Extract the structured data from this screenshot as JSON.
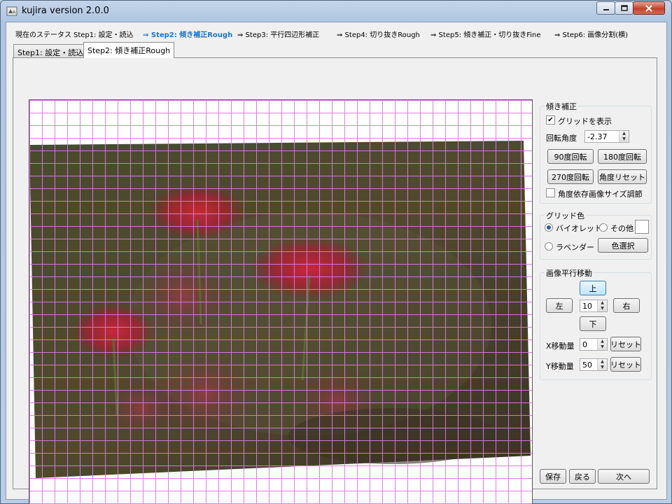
{
  "window": {
    "title": "kujira version 2.0.0"
  },
  "status": {
    "prefix": "現在のステータス",
    "steps": [
      {
        "text": "Step1: 設定・読込",
        "current": false
      },
      {
        "text": "⇒ Step2: 傾き補正Rough",
        "current": true
      },
      {
        "text": "⇒ Step3: 平行四辺形補正",
        "current": false
      },
      {
        "text": "⇒ Step4: 切り抜きRough",
        "current": false
      },
      {
        "text": "⇒ Step5: 傾き補正・切り抜きFine",
        "current": false
      },
      {
        "text": "⇒ Step6: 画像分割(横)",
        "current": false
      }
    ]
  },
  "tabs": [
    {
      "label": "Step1: 設定・読込",
      "active": false
    },
    {
      "label": "Step2: 傾き補正Rough",
      "active": true
    }
  ],
  "tilt": {
    "legend": "傾き補正",
    "show_grid_label": "グリッドを表示",
    "show_grid_checked": true,
    "angle_label": "回転角度",
    "angle_value": "-2.37",
    "rotate90": "90度回転",
    "rotate180": "180度回転",
    "rotate270": "270度回転",
    "angle_reset": "角度リセット",
    "resize_label": "角度依存画像サイズ調節",
    "resize_checked": false
  },
  "grid_color": {
    "legend": "グリッド色",
    "violet": "バイオレット",
    "other": "その他",
    "lavender": "ラベンダー",
    "choose_color": "色選択",
    "selected": "violet",
    "grid_hex": "#d67be0"
  },
  "translate": {
    "legend": "画像平行移動",
    "up": "上",
    "left": "左",
    "right": "右",
    "down": "下",
    "step_value": "10",
    "x_label": "X移動量",
    "x_value": "0",
    "y_label": "Y移動量",
    "y_value": "50",
    "reset": "リセット"
  },
  "footer": {
    "save": "保存",
    "back": "戻る",
    "next": "次へ"
  }
}
